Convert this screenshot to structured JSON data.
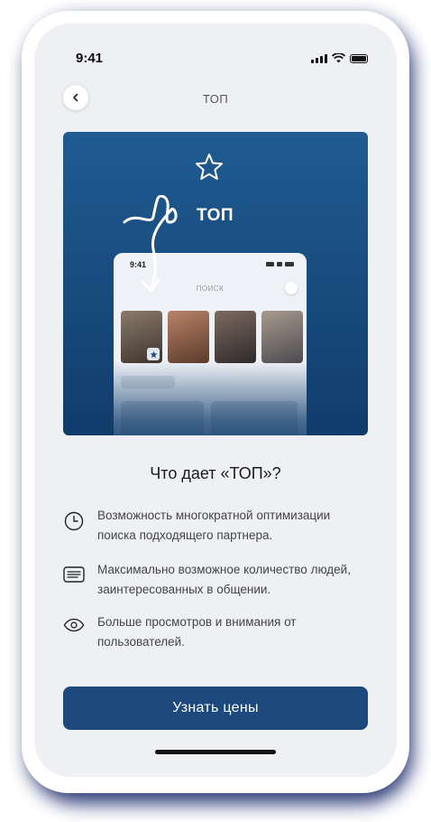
{
  "status": {
    "time": "9:41"
  },
  "nav": {
    "title": "ТОП",
    "back_icon": "chevron-left-icon"
  },
  "banner": {
    "title": "ТОП",
    "star_icon": "star-outline-icon",
    "mock": {
      "time": "9:41",
      "title": "ПОИСК"
    }
  },
  "content": {
    "heading": "Что дает «ТОП»?",
    "features": [
      {
        "icon": "clock-icon",
        "text": "Возможность многократной оптимизации поиска подходящего партнера."
      },
      {
        "icon": "chat-lines-icon",
        "text": "Максимально возможное количество людей, заинтересованных в общении."
      },
      {
        "icon": "eye-icon",
        "text": "Больше просмотров и внимания от пользователей."
      }
    ]
  },
  "cta": {
    "label": "Узнать цены"
  },
  "colors": {
    "accent": "#1c4a7e",
    "banner_top": "#1f5c91",
    "banner_bottom": "#103c6b",
    "screen_bg": "#eef0f4"
  }
}
